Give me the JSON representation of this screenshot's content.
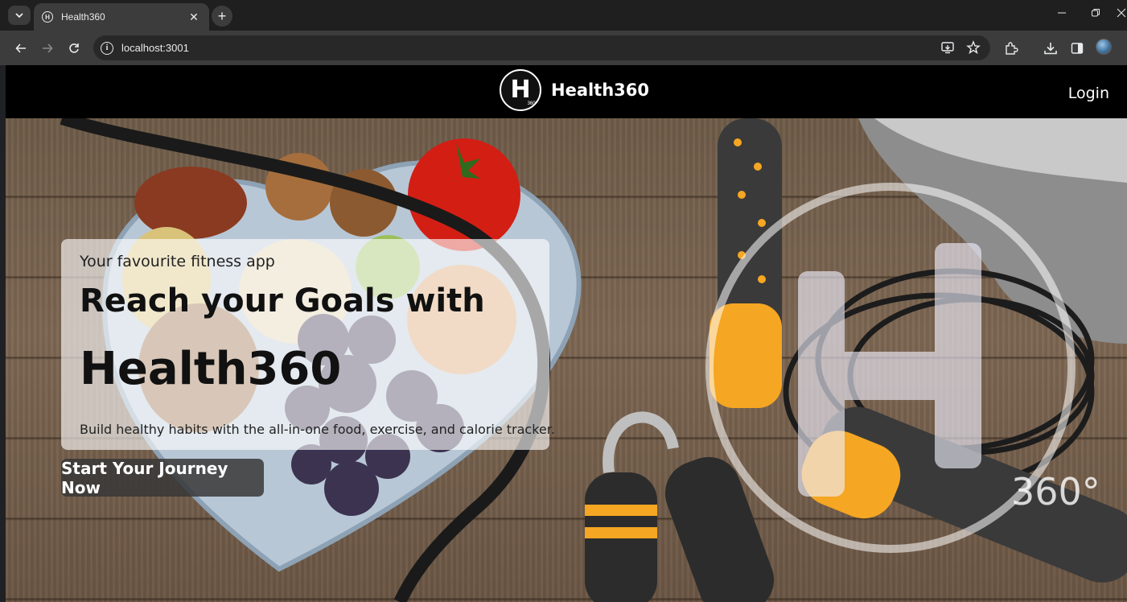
{
  "browser": {
    "tab_title": "Health360",
    "tab_close": "✕",
    "new_tab": "+",
    "url": "localhost:3001",
    "favicon_letter": "H"
  },
  "site": {
    "brand_name": "Health360",
    "logo_letter": "H",
    "logo_badge": "360°",
    "login_label": "Login"
  },
  "hero": {
    "subtitle": "Your favourite fitness app",
    "headline_line1": "Reach your Goals with",
    "headline_line2": "Health360",
    "description": "Build healthy habits with the all-in-one food, exercise, and calorie tracker.",
    "cta_label": "Start Your Journey Now",
    "watermark_badge": "360°"
  },
  "colors": {
    "header_bg": "#000000",
    "accent_orange": "#f5a623",
    "wood": "#75604c"
  }
}
